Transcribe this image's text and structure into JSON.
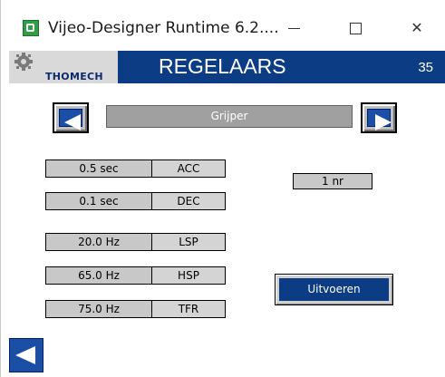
{
  "window": {
    "title": "Vijeo-Designer Runtime 6.2....",
    "controls": {
      "minimize": "minimize",
      "maximize": "maximize",
      "close": "✕"
    }
  },
  "header": {
    "logo_text": "THOMECH",
    "title": "REGELAARS",
    "screen_number": "35"
  },
  "selector": {
    "label": "Grijper"
  },
  "parameters": [
    {
      "value": "0.5 sec",
      "key": "ACC"
    },
    {
      "value": "0.1 sec",
      "key": "DEC"
    },
    {
      "value": "20.0 Hz",
      "key": "LSP"
    },
    {
      "value": "65.0 Hz",
      "key": "HSP"
    },
    {
      "value": "75.0 Hz",
      "key": "TFR"
    }
  ],
  "count_field": "1 nr",
  "execute_button": "Uitvoeren",
  "colors": {
    "header_bg": "#0c3c84",
    "nav_blue": "#1a4fa5",
    "field_gray": "#c8c8c8"
  }
}
